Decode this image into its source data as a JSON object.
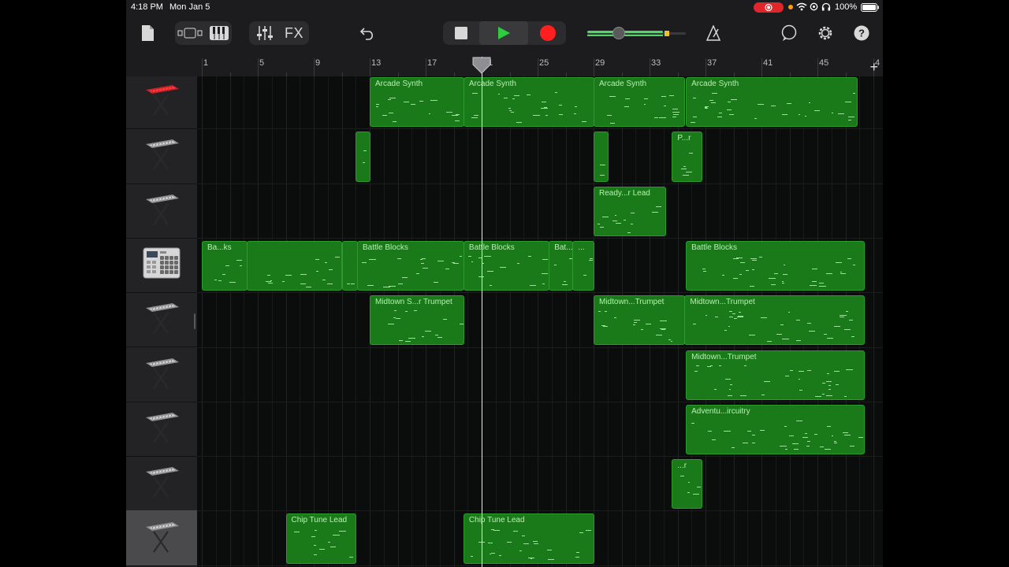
{
  "status_bar": {
    "time": "4:18 PM",
    "date": "Mon Jan 5",
    "battery": "100%",
    "icons": [
      "screen-record-icon",
      "wifi-icon",
      "location-icon",
      "headphones-icon",
      "battery-icon"
    ]
  },
  "toolbar": {
    "fx_label": "FX",
    "icons": [
      "document-icon",
      "track-view-icon",
      "piano-keys-icon",
      "mixer-icon",
      "undo-icon",
      "stop-icon",
      "play-icon",
      "record-icon",
      "metronome-icon",
      "loop-icon",
      "settings-icon",
      "help-icon"
    ],
    "master_volume": 0.28
  },
  "ruler": {
    "bars": [
      "1",
      "5",
      "9",
      "13",
      "17",
      "21",
      "25",
      "29",
      "33",
      "37",
      "41",
      "45",
      "4"
    ],
    "add_label": "+"
  },
  "tracks": [
    {
      "instrument": "keyboard-red",
      "selected": false
    },
    {
      "instrument": "keyboard",
      "selected": false
    },
    {
      "instrument": "keyboard",
      "selected": false
    },
    {
      "instrument": "drum-machine",
      "selected": false
    },
    {
      "instrument": "keyboard",
      "selected": false
    },
    {
      "instrument": "keyboard",
      "selected": false
    },
    {
      "instrument": "keyboard",
      "selected": false
    },
    {
      "instrument": "keyboard",
      "selected": false
    },
    {
      "instrument": "keyboard",
      "selected": true
    }
  ],
  "regions": [
    {
      "track": 0,
      "start_bar": 13.0,
      "end_bar": 19.7,
      "name": "Arcade Synth"
    },
    {
      "track": 0,
      "start_bar": 19.7,
      "end_bar": 29.0,
      "name": "Arcade Synth"
    },
    {
      "track": 0,
      "start_bar": 29.0,
      "end_bar": 35.5,
      "name": "Arcade Synth"
    },
    {
      "track": 0,
      "start_bar": 35.6,
      "end_bar": 47.8,
      "name": "Arcade Synth"
    },
    {
      "track": 1,
      "start_bar": 12.0,
      "end_bar": 13.0,
      "name": ""
    },
    {
      "track": 1,
      "start_bar": 29.0,
      "end_bar": 30.0,
      "name": ""
    },
    {
      "track": 1,
      "start_bar": 34.6,
      "end_bar": 36.7,
      "name": "P...r"
    },
    {
      "track": 2,
      "start_bar": 29.0,
      "end_bar": 34.1,
      "name": "Ready...r Lead"
    },
    {
      "track": 3,
      "start_bar": 1.0,
      "end_bar": 4.2,
      "name": "Ba...ks"
    },
    {
      "track": 3,
      "start_bar": 4.2,
      "end_bar": 11.0,
      "name": ""
    },
    {
      "track": 3,
      "start_bar": 11.0,
      "end_bar": 12.1,
      "name": ""
    },
    {
      "track": 3,
      "start_bar": 12.1,
      "end_bar": 19.7,
      "name": "Battle Blocks"
    },
    {
      "track": 3,
      "start_bar": 19.7,
      "end_bar": 25.8,
      "name": "Battle Blocks"
    },
    {
      "track": 3,
      "start_bar": 25.8,
      "end_bar": 27.5,
      "name": "Bat...cks"
    },
    {
      "track": 3,
      "start_bar": 27.5,
      "end_bar": 29.0,
      "name": "..."
    },
    {
      "track": 3,
      "start_bar": 35.6,
      "end_bar": 48.3,
      "name": "Battle Blocks"
    },
    {
      "track": 4,
      "start_bar": 13.0,
      "end_bar": 19.7,
      "name": "Midtown S...r Trumpet"
    },
    {
      "track": 4,
      "start_bar": 29.0,
      "end_bar": 35.5,
      "name": "Midtown...Trumpet"
    },
    {
      "track": 4,
      "start_bar": 35.5,
      "end_bar": 48.3,
      "name": "Midtown...Trumpet"
    },
    {
      "track": 5,
      "start_bar": 35.6,
      "end_bar": 48.3,
      "name": "Midtown...Trumpet"
    },
    {
      "track": 6,
      "start_bar": 35.6,
      "end_bar": 48.3,
      "name": "Adventu...ircuitry"
    },
    {
      "track": 7,
      "start_bar": 34.6,
      "end_bar": 36.7,
      "name": "...r"
    },
    {
      "track": 8,
      "start_bar": 7.0,
      "end_bar": 12.0,
      "name": "Chip Tune Lead"
    },
    {
      "track": 8,
      "start_bar": 19.7,
      "end_bar": 29.0,
      "name": "Chip Tune Lead"
    }
  ],
  "playhead_bar": 21.0
}
